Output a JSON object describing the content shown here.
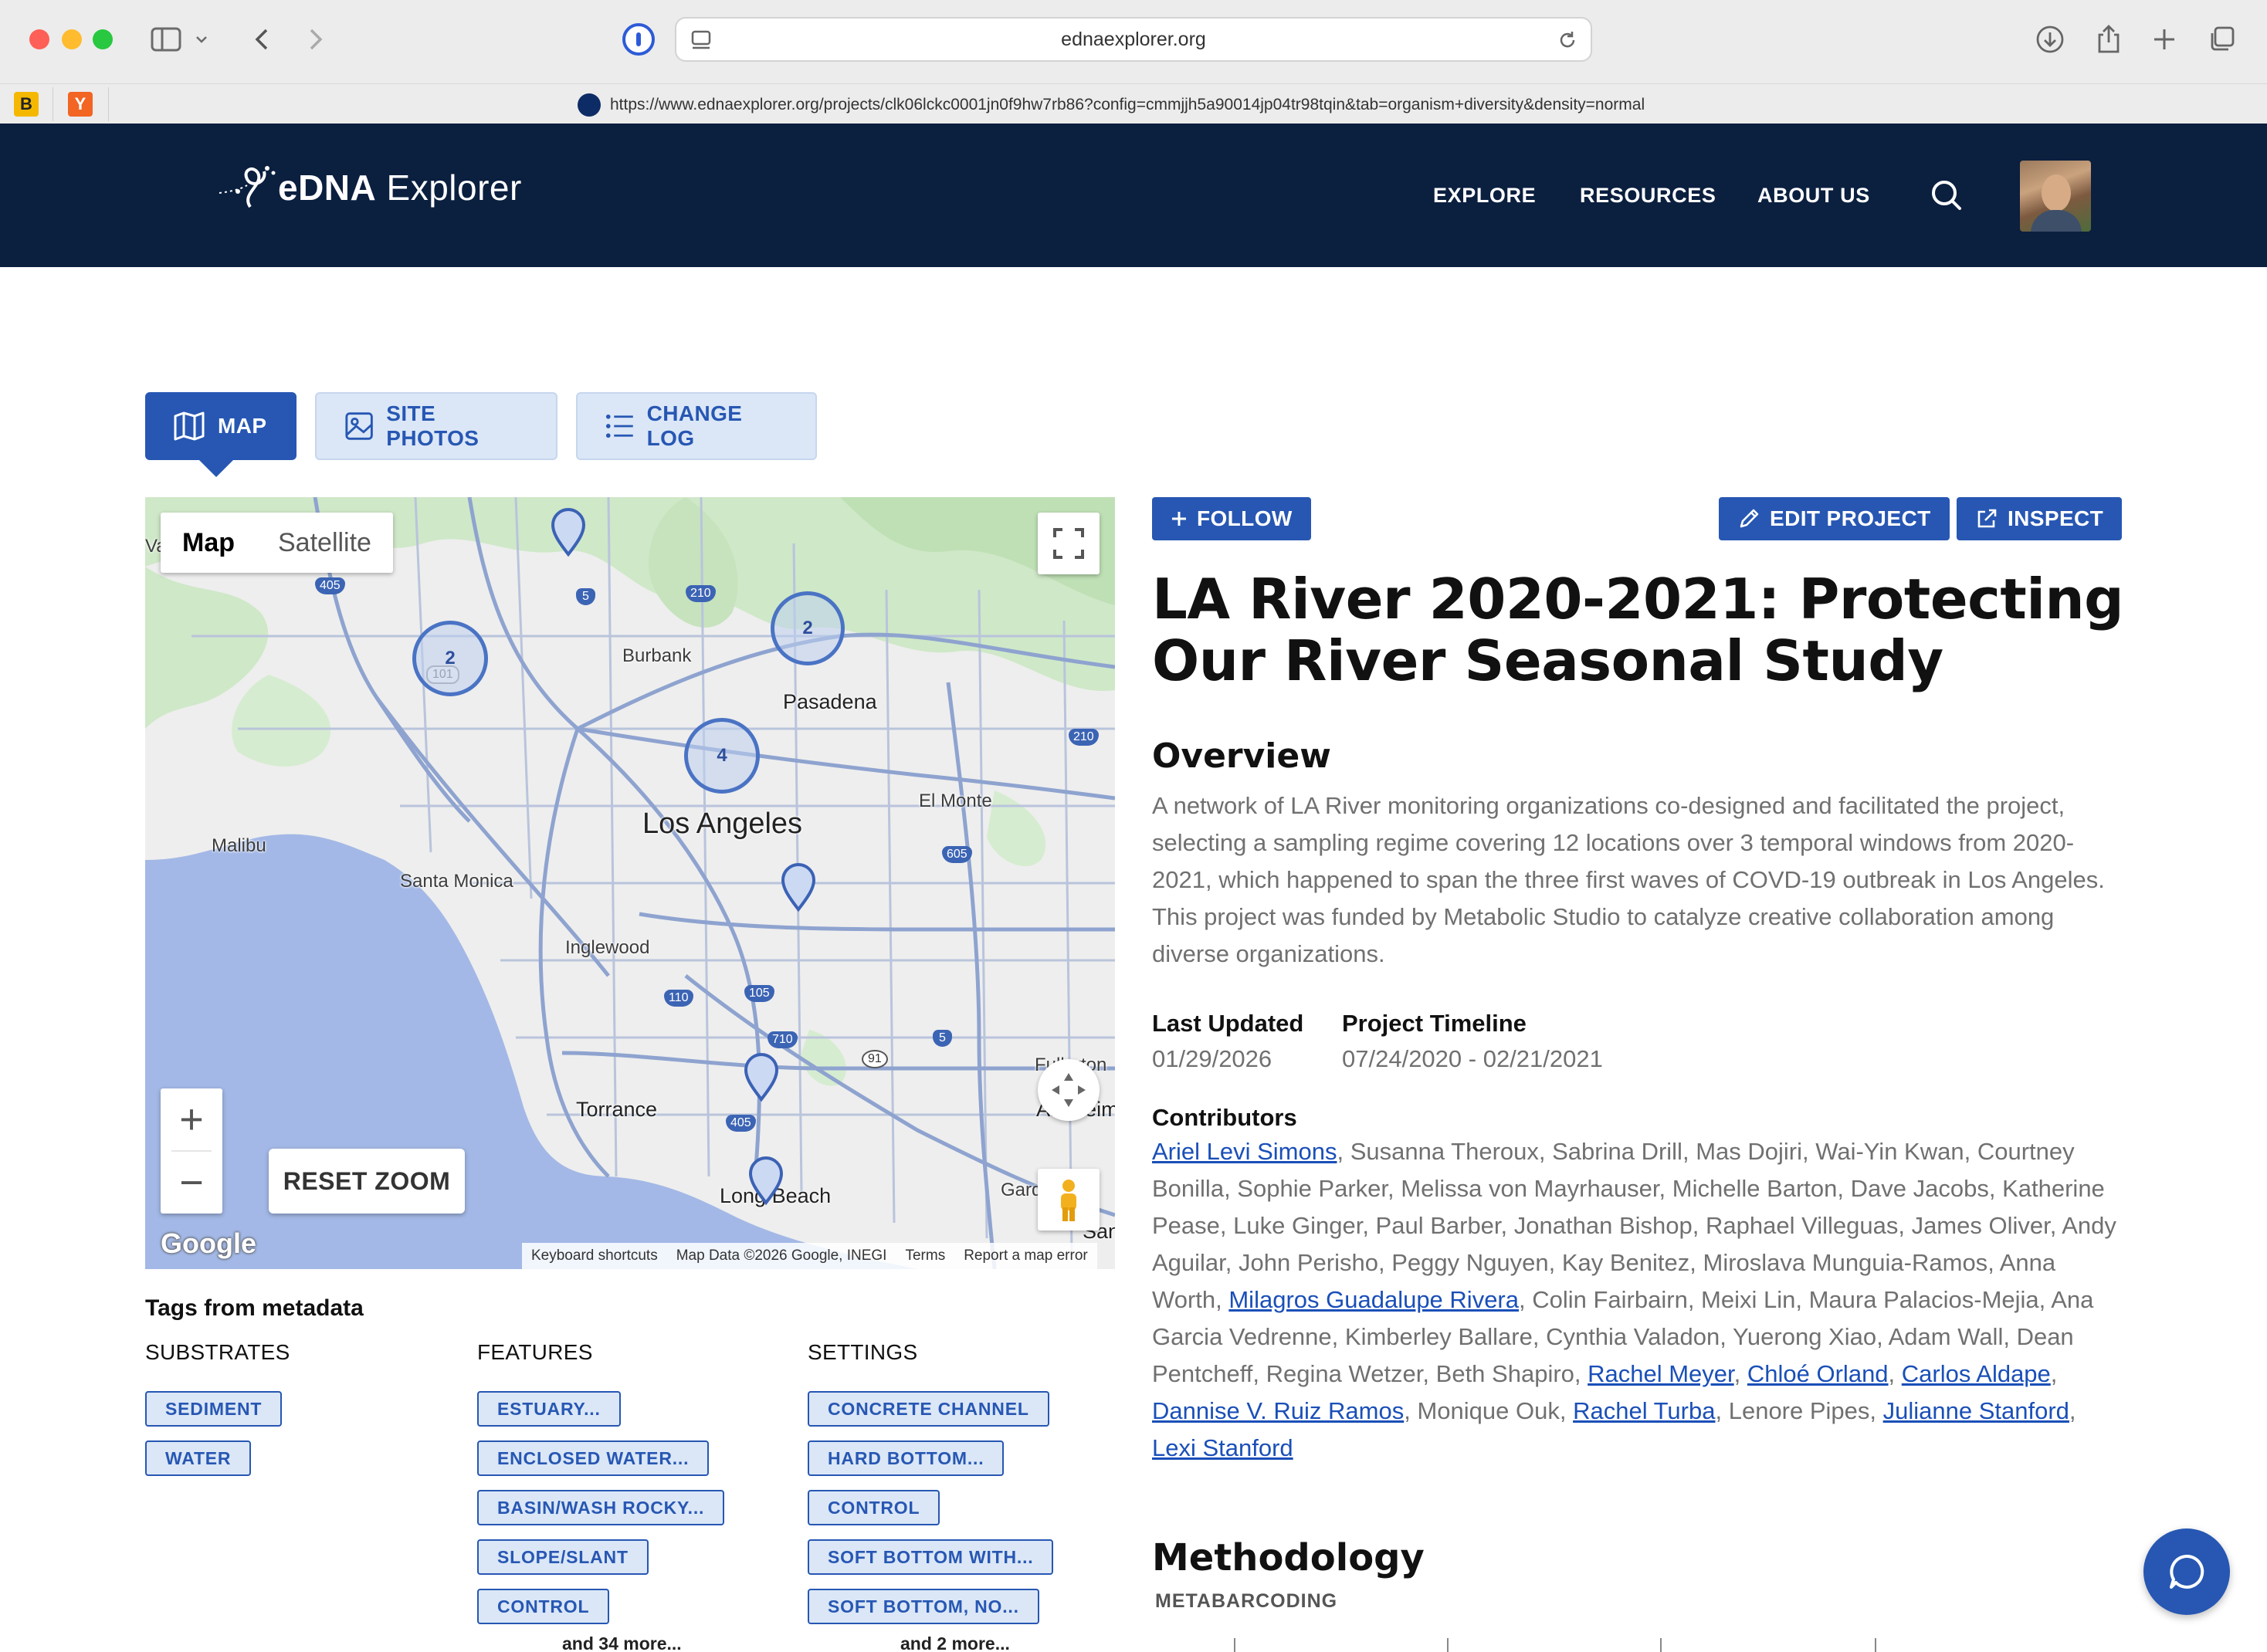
{
  "browser": {
    "address": "ednaexplorer.org",
    "full_url": "https://www.ednaexplorer.org/projects/clk06lckc0001jn0f9hw7rb86?config=cmmjjh5a90014jp04tr98tqin&tab=organism+diversity&density=normal",
    "favorites": [
      "B",
      "Y"
    ]
  },
  "header": {
    "logo_main": "eDNA",
    "logo_rest": " Explorer",
    "nav": [
      "EXPLORE",
      "RESOURCES",
      "ABOUT US"
    ]
  },
  "tabs": [
    "MAP",
    "SITE PHOTOS",
    "CHANGE LOG"
  ],
  "map": {
    "type_options": [
      "Map",
      "Satellite"
    ],
    "selected_type": "Map",
    "reset_label": "RESET ZOOM",
    "zoom_in": "+",
    "zoom_out": "−",
    "google": "Google",
    "attribution": [
      "Keyboard shortcuts",
      "Map Data ©2026 Google, INEGI",
      "Terms",
      "Report a map error"
    ],
    "places": {
      "la": "Los Angeles",
      "pasadena": "Pasadena",
      "burbank": "Burbank",
      "elmonte": "El Monte",
      "malibu": "Malibu",
      "santamonica": "Santa Monica",
      "inglewood": "Inglewood",
      "torrance": "Torrance",
      "longbeach": "Long Beach",
      "fullerton": "Fullerton",
      "anaheim": "Anaheim",
      "garden": "Gard",
      "va": "Va",
      "san": "San"
    },
    "highways": [
      "405",
      "5",
      "210",
      "101",
      "210",
      "605",
      "110",
      "105",
      "710",
      "5",
      "91",
      "405"
    ],
    "clusters": [
      "2",
      "2",
      "4"
    ]
  },
  "tags": {
    "title": "Tags from metadata",
    "substrates": {
      "title": "SUBSTRATES",
      "items": [
        "SEDIMENT",
        "WATER"
      ]
    },
    "features": {
      "title": "FEATURES",
      "items": [
        "ESTUARY...",
        "ENCLOSED WATER...",
        "BASIN/WASH ROCKY...",
        "SLOPE/SLANT",
        "CONTROL"
      ],
      "more": "and 34 more..."
    },
    "settings": {
      "title": "SETTINGS",
      "items": [
        "CONCRETE CHANNEL",
        "HARD BOTTOM...",
        "CONTROL",
        "SOFT BOTTOM WITH...",
        "SOFT BOTTOM, NO..."
      ],
      "more": "and 2 more..."
    }
  },
  "project": {
    "follow_label": "FOLLOW",
    "edit_label": "EDIT PROJECT",
    "inspect_label": "INSPECT",
    "title": "LA River 2020-2021: Protecting Our River Seasonal Study",
    "overview_heading": "Overview",
    "overview": "A network of LA River monitoring organizations co-designed and facilitated the project, selecting a sampling regime covering 12 locations over 3 temporal windows from 2020-2021, which happened to span the three first waves of COVD-19 outbreak in Los Angeles. This project was funded by Metabolic Studio to catalyze creative collaboration among diverse organizations.",
    "last_updated_label": "Last Updated",
    "last_updated": "01/29/2026",
    "timeline_label": "Project Timeline",
    "timeline": "07/24/2020 - 02/21/2021",
    "contributors_label": "Contributors",
    "contributors": [
      {
        "name": "Ariel Levi Simons",
        "link": true
      },
      {
        "name": "Susanna Theroux",
        "link": false
      },
      {
        "name": "Sabrina Drill",
        "link": false
      },
      {
        "name": "Mas Dojiri",
        "link": false
      },
      {
        "name": "Wai-Yin Kwan",
        "link": false
      },
      {
        "name": "Courtney Bonilla",
        "link": false
      },
      {
        "name": "Sophie Parker",
        "link": false
      },
      {
        "name": "Melissa von Mayrhauser",
        "link": false
      },
      {
        "name": "Michelle Barton",
        "link": false
      },
      {
        "name": "Dave Jacobs",
        "link": false
      },
      {
        "name": "Katherine Pease",
        "link": false
      },
      {
        "name": "Luke Ginger",
        "link": false
      },
      {
        "name": "Paul Barber",
        "link": false
      },
      {
        "name": "Jonathan Bishop",
        "link": false
      },
      {
        "name": "Raphael Villeguas",
        "link": false
      },
      {
        "name": "James Oliver",
        "link": false
      },
      {
        "name": "Andy Aguilar",
        "link": false
      },
      {
        "name": "John Perisho",
        "link": false
      },
      {
        "name": "Peggy Nguyen",
        "link": false
      },
      {
        "name": "Kay Benitez",
        "link": false
      },
      {
        "name": "Miroslava Munguia-Ramos",
        "link": false
      },
      {
        "name": "Anna Worth",
        "link": false
      },
      {
        "name": "Milagros Guadalupe Rivera",
        "link": true
      },
      {
        "name": "Colin Fairbairn",
        "link": false
      },
      {
        "name": "Meixi Lin",
        "link": false
      },
      {
        "name": "Maura Palacios-Mejia",
        "link": false
      },
      {
        "name": "Ana Garcia Vedrenne",
        "link": false
      },
      {
        "name": "Kimberley Ballare",
        "link": false
      },
      {
        "name": "Cynthia Valadon",
        "link": false
      },
      {
        "name": "Yuerong Xiao",
        "link": false
      },
      {
        "name": "Adam Wall",
        "link": false
      },
      {
        "name": "Dean Pentcheff",
        "link": false
      },
      {
        "name": "Regina Wetzer",
        "link": false
      },
      {
        "name": "Beth Shapiro",
        "link": false
      },
      {
        "name": "Rachel Meyer",
        "link": true
      },
      {
        "name": "Chloé Orland",
        "link": true
      },
      {
        "name": "Carlos Aldape",
        "link": true
      },
      {
        "name": "Dannise V. Ruiz Ramos",
        "link": true
      },
      {
        "name": "Monique Ouk",
        "link": false
      },
      {
        "name": "Rachel Turba",
        "link": true
      },
      {
        "name": "Lenore Pipes",
        "link": false
      },
      {
        "name": "Julianne Stanford",
        "link": true
      },
      {
        "name": "Lexi Stanford",
        "link": true
      }
    ],
    "methodology_heading": "Methodology",
    "methodology_sub": "METABARCODING"
  },
  "colors": {
    "header_bg": "#0b1f3f",
    "accent": "#2757b3",
    "tag_bg": "#dbe7f7",
    "link": "#1a4fb8"
  }
}
